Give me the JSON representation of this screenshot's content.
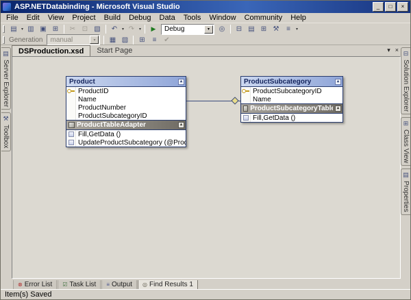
{
  "window": {
    "title": "ASP.NETDatabinding - Microsoft Visual Studio",
    "status": "Item(s) Saved"
  },
  "chrome": {
    "minimize_glyph": "_",
    "maximize_glyph": "□",
    "close_glyph": "×",
    "dropdown_glyph": "▾",
    "collapse_glyph": "▴"
  },
  "menu": {
    "items": [
      "File",
      "Edit",
      "View",
      "Project",
      "Build",
      "Debug",
      "Data",
      "Tools",
      "Window",
      "Community",
      "Help"
    ]
  },
  "toolbar1": {
    "debug_combo_value": "Debug",
    "icons": [
      {
        "name": "new-project-icon",
        "glyph": "▤"
      },
      {
        "name": "open-file-icon",
        "glyph": "▥"
      },
      {
        "name": "save-icon",
        "glyph": "▣"
      },
      {
        "name": "save-all-icon",
        "glyph": "⊞"
      },
      {
        "name": "cut-icon",
        "glyph": "✂"
      },
      {
        "name": "copy-icon",
        "glyph": "⊡"
      },
      {
        "name": "paste-icon",
        "glyph": "▧"
      },
      {
        "name": "undo-icon",
        "glyph": "↶"
      },
      {
        "name": "redo-icon",
        "glyph": "↷"
      },
      {
        "name": "start-debug-icon",
        "glyph": "▶"
      },
      {
        "name": "find-icon",
        "glyph": "◎"
      },
      {
        "name": "solution-explorer-icon",
        "glyph": "⊟"
      },
      {
        "name": "properties-window-icon",
        "glyph": "▤"
      },
      {
        "name": "object-browser-icon",
        "glyph": "⊞"
      },
      {
        "name": "toolbox-icon",
        "glyph": "⚒"
      },
      {
        "name": "command-window-icon",
        "glyph": "≡"
      }
    ]
  },
  "toolbar2": {
    "generation_label": "Generation",
    "generation_value": "manual",
    "icons": [
      {
        "name": "generate-dataset-icon",
        "glyph": "▦"
      },
      {
        "name": "preview-data-icon",
        "glyph": "▧"
      },
      {
        "name": "edit-key-icon",
        "glyph": "⊞"
      },
      {
        "name": "edit-relation-icon",
        "glyph": "≡"
      },
      {
        "name": "validate-schema-icon",
        "glyph": "✔"
      }
    ]
  },
  "doc_tabs": [
    {
      "label": "DSProduction.xsd"
    },
    {
      "label": "Start Page"
    }
  ],
  "left_tabs": [
    {
      "label": "Server Explorer"
    },
    {
      "label": "Toolbox"
    }
  ],
  "right_tabs": [
    {
      "label": "Solution Explorer"
    },
    {
      "label": "Class View"
    },
    {
      "label": "Properties"
    }
  ],
  "bottom_tabs": [
    {
      "label": "Error List"
    },
    {
      "label": "Task List"
    },
    {
      "label": "Output"
    },
    {
      "label": "Find Results 1"
    }
  ],
  "designer": {
    "tables": [
      {
        "title": "Product",
        "rows": [
          "ProductID",
          "Name",
          "ProductNumber",
          "ProductSubcategoryID"
        ],
        "adapter_title": "ProductTableAdapter",
        "methods": [
          "Fill,GetData ()",
          "UpdateProductSubcategory (@ProductSubcategoryI..."
        ]
      },
      {
        "title": "ProductSubcategory",
        "rows": [
          "ProductSubcategoryID",
          "Name"
        ],
        "adapter_title": "ProductSubcategoryTableAdapter",
        "methods": [
          "Fill,GetData ()"
        ]
      }
    ]
  },
  "colors": {
    "titlebar_from": "#0a246a",
    "titlebar_to": "#3a66b8",
    "chrome_bg": "#d4d0c8",
    "canvas_bg": "#dcd9d1",
    "table_header_from": "#ccd8f0",
    "table_header_to": "#8fa5d8",
    "adapter_header_from": "#aaa69e",
    "adapter_header_to": "#6f6b63",
    "table_border": "#2a3d6e",
    "key_color": "#c49a1a"
  }
}
